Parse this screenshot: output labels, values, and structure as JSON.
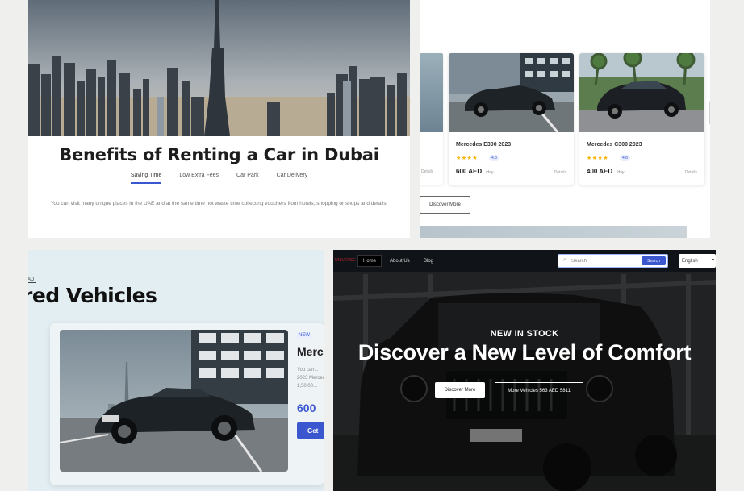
{
  "benefits": {
    "title": "Benefits of Renting a Car in Dubai",
    "tabs": [
      "Saving Time",
      "Low Extra Fees",
      "Car Park",
      "Car Delivery"
    ],
    "active_tab_index": 0,
    "body": "You can visit many unique places in the UAE and at the same time not waste time collecting vouchers from hotels, shopping or shops and details."
  },
  "car_list": {
    "partial_card_text": "Details",
    "cards": [
      {
        "name": "Mercedes E300 2023",
        "stars": "★★★★",
        "rating": "4.8",
        "price": "600 AED",
        "per": "/day",
        "tag": "Details"
      },
      {
        "name": "Mercedes C300 2023",
        "stars": "★★★★",
        "rating": "4.8",
        "price": "400 AED",
        "per": "/day",
        "tag": "Details"
      }
    ],
    "discover_label": "Discover More"
  },
  "featured": {
    "badge": "AD",
    "title": "red Vehicles",
    "card": {
      "tag": "NEW",
      "name": "Merc",
      "desc_lines": [
        "You can...",
        "2023 Mercedes...",
        "1,50,00..."
      ],
      "price": "600",
      "button_label": "Get"
    }
  },
  "hero": {
    "logo": "UNIVERSE",
    "nav": [
      "Home",
      "About Us",
      "Blog"
    ],
    "active_nav_index": 0,
    "search_placeholder": "Search",
    "search_button": "Search",
    "language": "English",
    "kicker": "NEW IN STOCK",
    "headline": "Discover a New Level of Comfort",
    "primary_button": "Discover More",
    "secondary_button": "More Vehicles 563 AED 5811"
  },
  "colors": {
    "accent": "#3b57d0",
    "star": "#f5b400",
    "hero_nav": "#101317"
  }
}
